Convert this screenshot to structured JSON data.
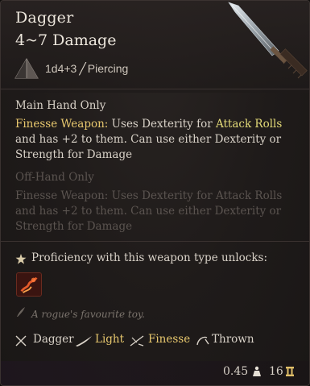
{
  "item": {
    "name": "Dagger",
    "damage_range": "4~7 Damage",
    "damage_dice": "1d4+3",
    "damage_type": "Piercing"
  },
  "main_hand": {
    "header": "Main Hand Only",
    "feature_name": "Finesse Weapon:",
    "desc_1": " Uses Dexterity for ",
    "highlight": "Attack Rolls",
    "desc_2": " and has +2 to them. Can use either Dexterity or Strength for Damage"
  },
  "off_hand": {
    "header": "Off-Hand Only",
    "feature_name": "Finesse Weapon:",
    "desc": " Uses Dexterity for Attack Rolls and has +2 to them. Can use either Dexterity or Strength for Damage"
  },
  "proficiency": {
    "text": "Proficiency with this weapon type unlocks:",
    "icon": "star-icon",
    "unlock_icon": "fire-slash-icon"
  },
  "flavor_text": "A rogue's favourite toy.",
  "tags": [
    {
      "label": "Dagger",
      "icon": "crossed-daggers-icon",
      "color": "#d9d2c8"
    },
    {
      "label": "Light",
      "icon": "feather-icon",
      "color": "#e8c86e"
    },
    {
      "label": "Finesse",
      "icon": "finesse-icon",
      "color": "#e8c86e"
    },
    {
      "label": "Thrown",
      "icon": "thrown-icon",
      "color": "#d9d2c8"
    }
  ],
  "footer": {
    "weight": "0.45",
    "value": "16",
    "weight_icon": "weight-icon",
    "value_icon": "coin-icon"
  },
  "colors": {
    "accent_gold": "#e8c86e",
    "text_primary": "#d9d2c8",
    "text_dim": "#5b5450",
    "background": "#1f1b1a"
  }
}
